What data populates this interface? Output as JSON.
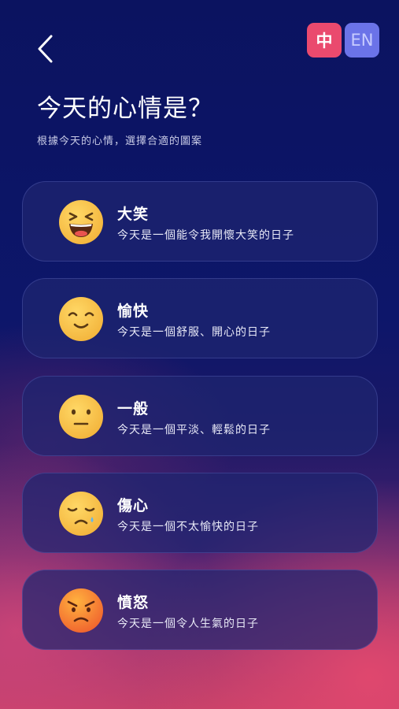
{
  "header": {
    "lang_zh": "中",
    "lang_en": "EN"
  },
  "title": "今天的心情是？",
  "subtitle": "根據今天的心情，選擇合適的圖案",
  "moods": [
    {
      "name": "大笑",
      "desc": "今天是一個能令我開懷大笑的日子",
      "icon": "laughing-face-icon"
    },
    {
      "name": "愉快",
      "desc": "今天是一個舒服、開心的日子",
      "icon": "smiling-face-icon"
    },
    {
      "name": "一般",
      "desc": "今天是一個平淡、輕鬆的日子",
      "icon": "neutral-face-icon"
    },
    {
      "name": "傷心",
      "desc": "今天是一個不太愉快的日子",
      "icon": "sad-face-icon"
    },
    {
      "name": "憤怒",
      "desc": "今天是一個令人生氣的日子",
      "icon": "angry-face-icon"
    }
  ],
  "colors": {
    "accent_zh": "#ea4a6e",
    "accent_en": "#6b73e8",
    "emoji_yellow": "#f8c44e",
    "emoji_angry": "#f26b3a"
  }
}
